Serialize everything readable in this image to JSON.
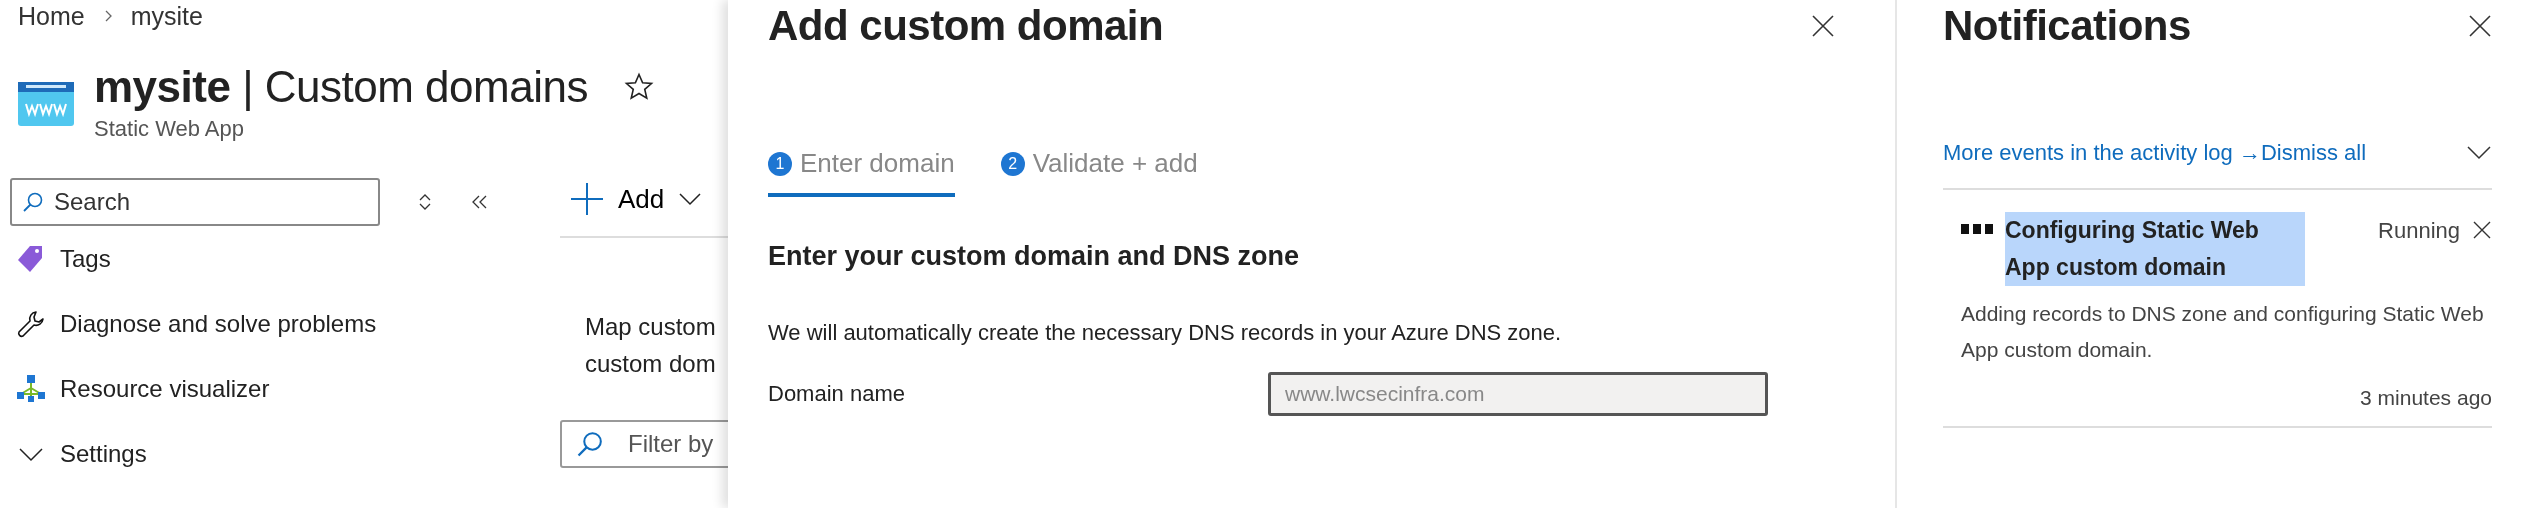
{
  "breadcrumb": [
    {
      "label": "Home"
    },
    {
      "label": "mysite"
    }
  ],
  "page": {
    "resource": "mysite",
    "separator": "|",
    "section": "Custom domains",
    "subtitle": "Static Web App",
    "favorite": false
  },
  "sidebar": {
    "search": {
      "placeholder": "Search"
    },
    "items": [
      {
        "kind": "tags",
        "label": "Tags"
      },
      {
        "kind": "wrench",
        "label": "Diagnose and solve problems"
      },
      {
        "kind": "hierarchy",
        "label": "Resource visualizer"
      },
      {
        "kind": "group",
        "label": "Settings",
        "expanded": true
      }
    ]
  },
  "content": {
    "add_button": "Add",
    "description_lines": [
      "Map custom",
      "custom dom"
    ],
    "filter": {
      "placeholder": "Filter by"
    }
  },
  "dialog": {
    "title": "Add custom domain",
    "steps": [
      {
        "number": "1",
        "label": "Enter domain",
        "selected": true
      },
      {
        "number": "2",
        "label": "Validate + add",
        "selected": false
      }
    ],
    "heading": "Enter your custom domain and DNS zone",
    "description": "We will automatically create the necessary DNS records in your Azure DNS zone.",
    "field": {
      "label": "Domain name",
      "value": "www.lwcsecinfra.com",
      "disabled": true
    }
  },
  "notifications": {
    "title": "Notifications",
    "activity_link": "More events in the activity log →",
    "dismiss_all": "Dismiss all",
    "items": [
      {
        "title": "Configuring Static Web App custom domain",
        "highlighted": true,
        "status": "Running",
        "message": "Adding records to DNS zone and configuring Static Web App custom domain.",
        "time": "3 minutes ago"
      }
    ]
  }
}
